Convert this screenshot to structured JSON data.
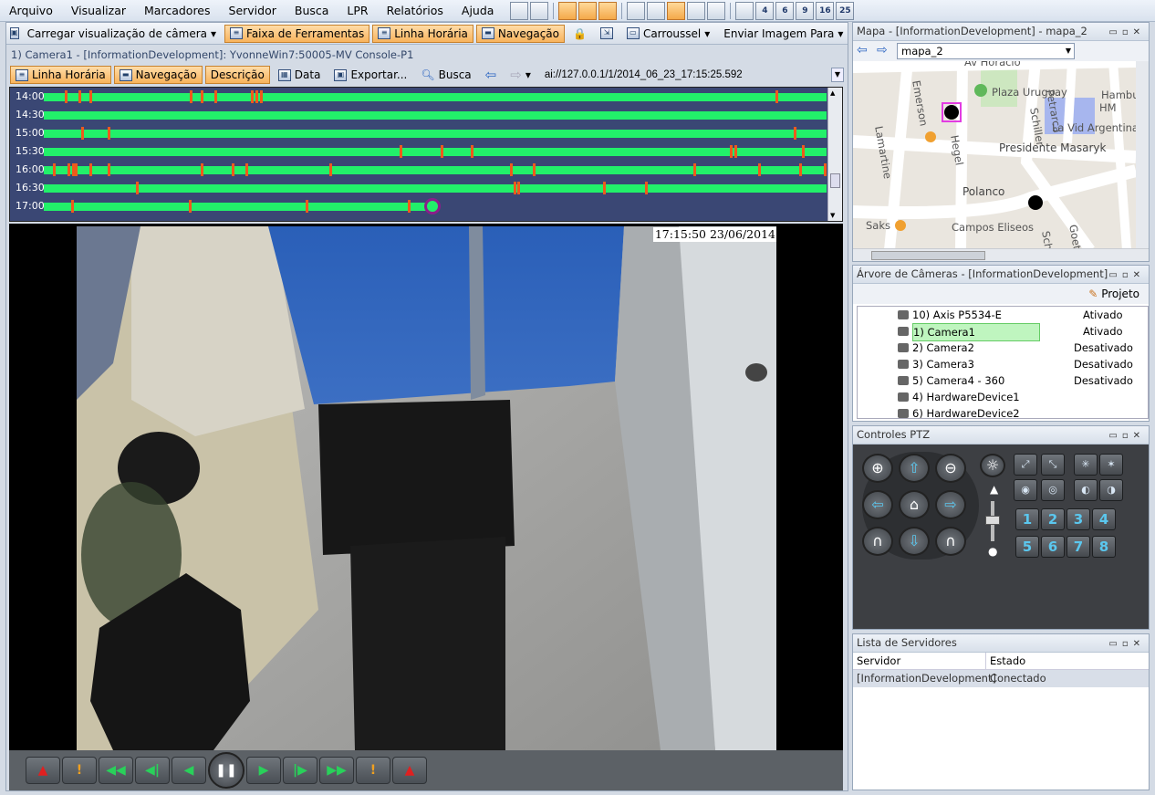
{
  "menu": [
    "Arquivo",
    "Visualizar",
    "Marcadores",
    "Servidor",
    "Busca",
    "LPR",
    "Relatórios",
    "Ajuda"
  ],
  "menu_icons": [
    "add-icon",
    "edit-icon",
    "layout1-icon",
    "layout2-icon",
    "move-icon",
    "layout3-icon",
    "layout4-icon",
    "grid-icon",
    "layout5-icon",
    "layout6-icon",
    "view1-icon",
    "view4-icon",
    "view6-icon",
    "view9-icon",
    "view16-icon",
    "view25-icon"
  ],
  "menu_icon_labels": [
    "",
    "",
    "",
    "",
    "",
    "",
    "",
    "",
    "",
    "",
    "",
    "4",
    "6",
    "9",
    "16",
    "25"
  ],
  "toolbar1": {
    "load_view": "Carregar visualização de câmera",
    "tools": "Faixa de Ferramentas",
    "timeline": "Linha Horária",
    "navigation": "Navegação",
    "carousel": "Carroussel",
    "send_image": "Enviar Imagem Para"
  },
  "camera_title": "1) Camera1 - [InformationDevelopment]: YvonneWin7:50005-MV Console-P1",
  "toolbar2": {
    "timeline": "Linha Horária",
    "navigation": "Navegação",
    "description": "Descrição",
    "date": "Data",
    "export": "Exportar...",
    "search": "Busca",
    "url": "ai://127.0.0.1/1/2014_06_23_17:15:25.592"
  },
  "timeline": {
    "rows": [
      {
        "time": "14:00",
        "marks": [
          0.027,
          0.044,
          0.058,
          0.187,
          0.2,
          0.218,
          0.264,
          0.27,
          0.276,
          0.935
        ]
      },
      {
        "time": "14:30",
        "marks": []
      },
      {
        "time": "15:00",
        "marks": [
          0.048,
          0.082,
          0.958
        ]
      },
      {
        "time": "15:30",
        "marks": [
          0.455,
          0.507,
          0.545,
          0.877,
          0.882,
          0.968
        ]
      },
      {
        "time": "16:00",
        "marks": [
          0.012,
          0.03,
          0.036,
          0.04,
          0.058,
          0.082,
          0.2,
          0.24,
          0.257,
          0.365,
          0.596,
          0.625,
          0.83,
          0.913,
          0.965,
          0.996
        ]
      },
      {
        "time": "16:30",
        "marks": [
          0.118,
          0.6,
          0.605,
          0.715,
          0.768
        ]
      },
      {
        "time": "17:00",
        "marks": [
          0.035,
          0.185,
          0.335,
          0.465
        ]
      }
    ],
    "fill": [
      1,
      1,
      1,
      1,
      1,
      1,
      0.5
    ]
  },
  "video": {
    "timestamp": "17:15:50 23/06/2014"
  },
  "controls": [
    {
      "name": "first-alarm-button",
      "glyph": "▲",
      "color": "red"
    },
    {
      "name": "prev-event-button",
      "glyph": "!",
      "color": "orange"
    },
    {
      "name": "fast-rewind-button",
      "glyph": "◀◀",
      "color": "green"
    },
    {
      "name": "rewind-button",
      "glyph": "◀|",
      "color": "green"
    },
    {
      "name": "step-back-button",
      "glyph": "◀",
      "color": "green"
    },
    {
      "name": "pause-button",
      "glyph": "❚❚",
      "color": "pause"
    },
    {
      "name": "step-forward-button",
      "glyph": "▶",
      "color": "green"
    },
    {
      "name": "forward-button",
      "glyph": "|▶",
      "color": "green"
    },
    {
      "name": "fast-forward-button",
      "glyph": "▶▶",
      "color": "green"
    },
    {
      "name": "next-event-button",
      "glyph": "!",
      "color": "orange"
    },
    {
      "name": "last-alarm-button",
      "glyph": "▲",
      "color": "red"
    }
  ],
  "map": {
    "title": "Mapa - [InformationDevelopment] - mapa_2",
    "selected": "mapa_2",
    "labels": [
      "Av Horacio",
      "Plaza Uruguay",
      "Hamburgo",
      "HM",
      "La Vid Argentina",
      "Emerson",
      "Petrarca",
      "Schiller",
      "Lamartine",
      "Hegel",
      "Presidente Masaryk",
      "Polanco",
      "Saks",
      "Campos Eliseos",
      "Schiller",
      "Goethe"
    ]
  },
  "tree": {
    "title": "Árvore de Câmeras - [InformationDevelopment]",
    "project": "Projeto",
    "items": [
      {
        "name": "10) Axis P5534-E",
        "status": "Ativado"
      },
      {
        "name": "1) Camera1",
        "status": "Ativado"
      },
      {
        "name": "2) Camera2",
        "status": "Desativado"
      },
      {
        "name": "3) Camera3",
        "status": "Desativado"
      },
      {
        "name": "5) Camera4 - 360",
        "status": "Desativado"
      },
      {
        "name": "4) HardwareDevice1",
        "status": ""
      },
      {
        "name": "6) HardwareDevice2",
        "status": ""
      }
    ]
  },
  "ptz": {
    "title": "Controles PTZ",
    "presets": [
      "1",
      "2",
      "3",
      "4",
      "5",
      "6",
      "7",
      "8"
    ]
  },
  "servers": {
    "title": "Lista de Servidores",
    "col_server": "Servidor",
    "col_state": "Estado",
    "rows": [
      {
        "server": "[InformationDevelopment]",
        "state": "Conectado"
      }
    ]
  }
}
